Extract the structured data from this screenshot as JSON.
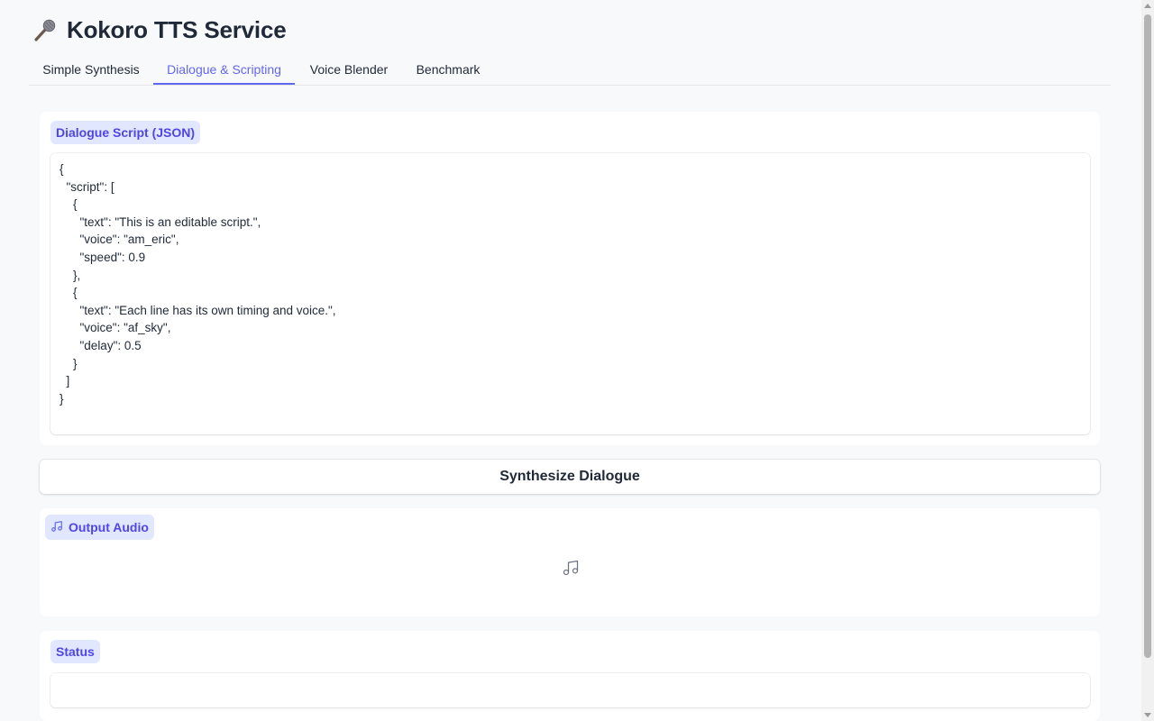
{
  "header": {
    "title": "Kokoro TTS Service",
    "icon": "microphone-icon"
  },
  "tabs": [
    {
      "label": "Simple Synthesis",
      "active": false
    },
    {
      "label": "Dialogue & Scripting",
      "active": true
    },
    {
      "label": "Voice Blender",
      "active": false
    },
    {
      "label": "Benchmark",
      "active": false
    }
  ],
  "dialogue": {
    "label": "Dialogue Script (JSON)",
    "script": "{\n  \"script\": [\n    {\n      \"text\": \"This is an editable script.\",\n      \"voice\": \"am_eric\",\n      \"speed\": 0.9\n    },\n    {\n      \"text\": \"Each line has its own timing and voice.\",\n      \"voice\": \"af_sky\",\n      \"delay\": 0.5\n    }\n  ]\n}"
  },
  "synthesize_button": {
    "label": "Synthesize Dialogue"
  },
  "output": {
    "label": "Output Audio",
    "icon": "music-note-icon"
  },
  "status": {
    "label": "Status",
    "value": ""
  },
  "colors": {
    "accent": "#6366f1",
    "chip_bg": "#e0e7ff",
    "page_bg": "#f8f9fb"
  }
}
